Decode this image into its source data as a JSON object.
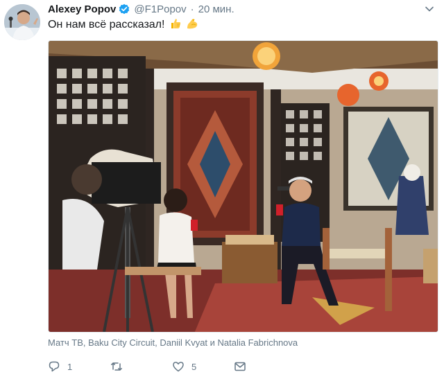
{
  "tweet": {
    "author_name": "Alexey Popov",
    "handle": "@F1Popov",
    "separator": "·",
    "time": "20 мин.",
    "text": "Он нам всё рассказал!",
    "emoji": [
      "thumbs-up-emoji",
      "flexed-biceps-emoji"
    ],
    "photo_tags": "Матч ТВ, Baku City Circuit, Daniil Kvyat и Natalia Fabrichnova"
  },
  "actions": {
    "reply_count": "1",
    "retweet_count": "",
    "like_count": "5"
  },
  "icons": {
    "verified": "verified-badge-icon",
    "caret": "chevron-down-icon",
    "reply": "reply-icon",
    "retweet": "retweet-icon",
    "like": "heart-icon",
    "dm": "envelope-icon"
  },
  "colors": {
    "text": "#14171a",
    "secondary": "#657786",
    "verified": "#1da1f2",
    "emoji_yellow": "#ffcc4d"
  }
}
